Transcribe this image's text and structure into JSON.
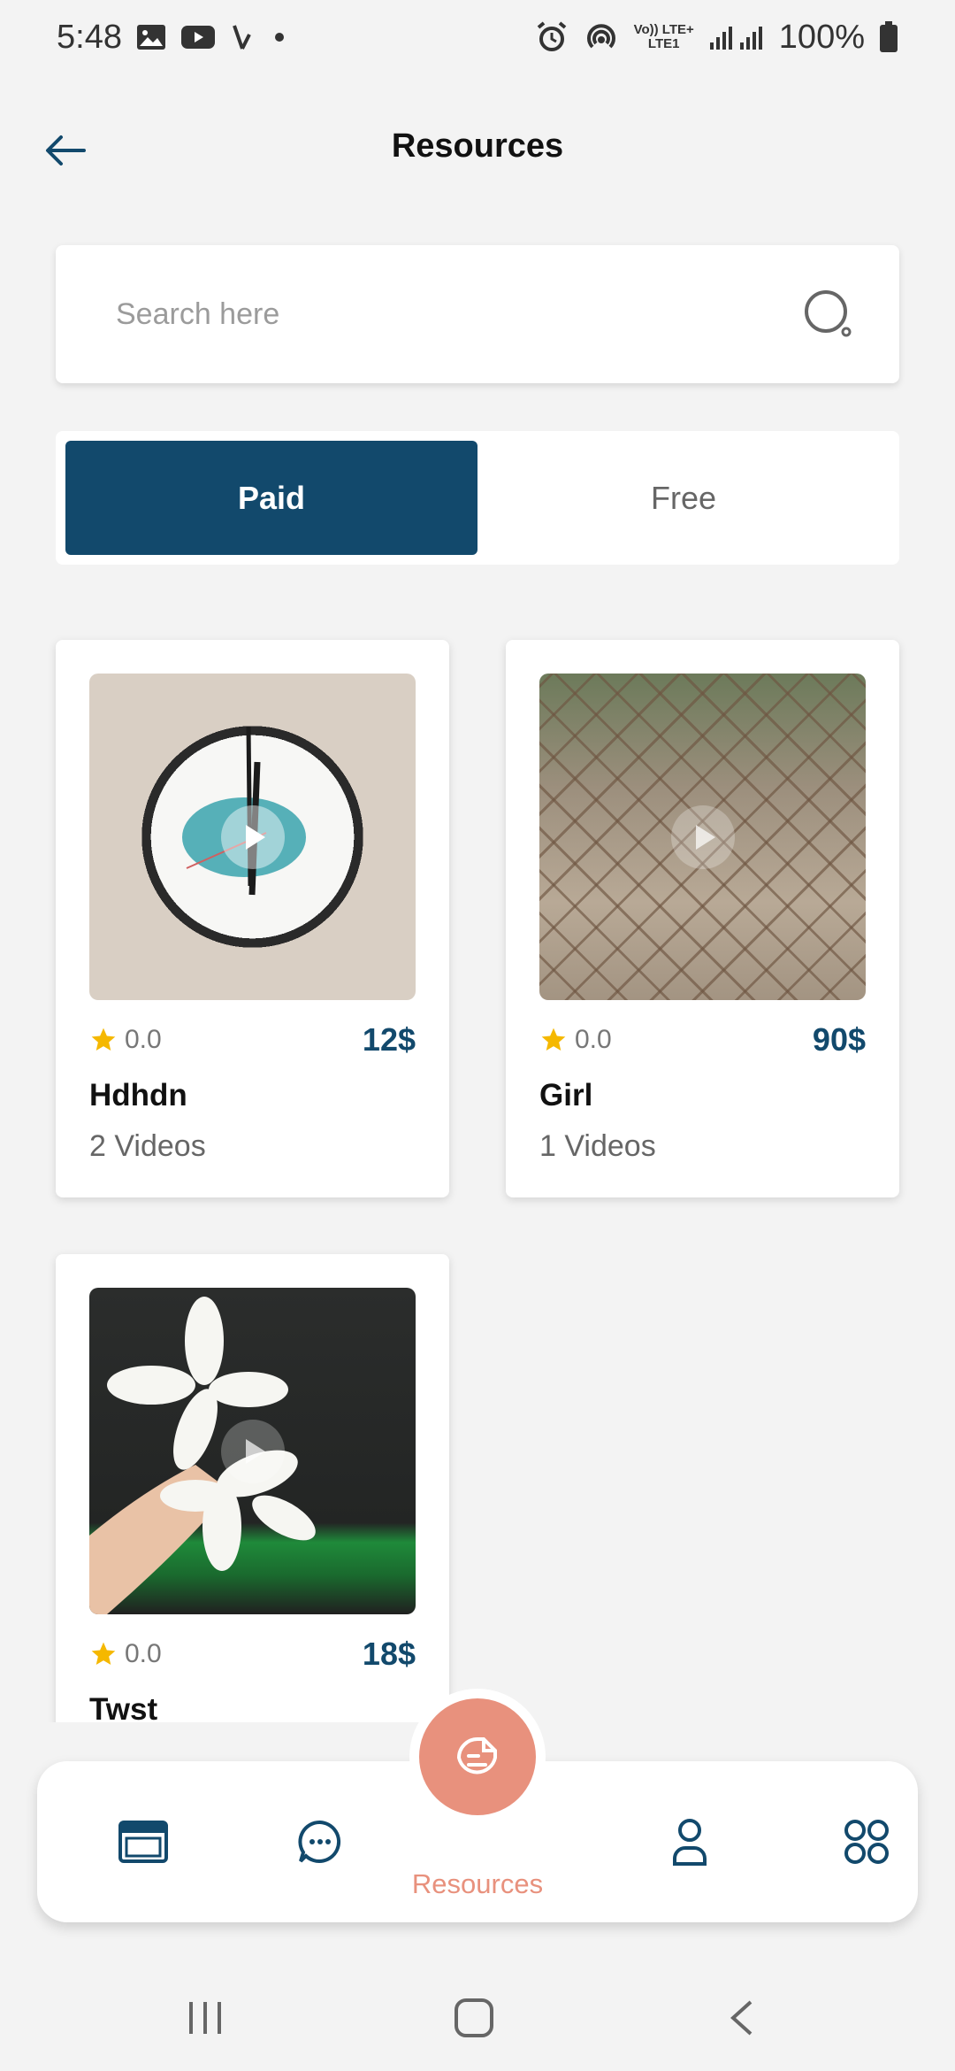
{
  "status_bar": {
    "time": "5:48",
    "battery": "100%",
    "icons": [
      "gallery-icon",
      "youtube-icon",
      "call-icon",
      "dot-icon",
      "alarm-icon",
      "hotspot-icon",
      "volte-icon",
      "signal-icon",
      "battery-icon"
    ],
    "volte_line1": "Vo)) LTE+",
    "volte_line2": "LTE1"
  },
  "header": {
    "title": "Resources",
    "back_icon": "arrow-left-icon"
  },
  "search": {
    "placeholder": "Search here",
    "icon": "search-icon"
  },
  "toggle": {
    "paid_label": "Paid",
    "free_label": "Free",
    "selected": "Paid"
  },
  "cards": [
    {
      "title": "Hdhdn",
      "subtitle": "2 Videos",
      "rating": "0.0",
      "price": "12$",
      "thumb": "clock-video-thumbnail"
    },
    {
      "title": "Girl",
      "subtitle": "1 Videos",
      "rating": "0.0",
      "price": "90$",
      "thumb": "fence-video-thumbnail"
    },
    {
      "title": "Twst",
      "subtitle": "",
      "rating": "0.0",
      "price": "18$",
      "thumb": "flower-video-thumbnail"
    }
  ],
  "bottom_nav": {
    "items": [
      {
        "icon": "browser-icon"
      },
      {
        "icon": "chat-icon"
      },
      {
        "icon": "resources-icon",
        "label": "Resources",
        "active": true
      },
      {
        "icon": "profile-icon"
      },
      {
        "icon": "grid-icon"
      }
    ],
    "active_color": "#e8917d",
    "icon_color": "#12496c"
  },
  "colors": {
    "primary": "#12496c",
    "accent": "#e8917d",
    "star": "#f5b800",
    "background": "#f3f3f3"
  }
}
